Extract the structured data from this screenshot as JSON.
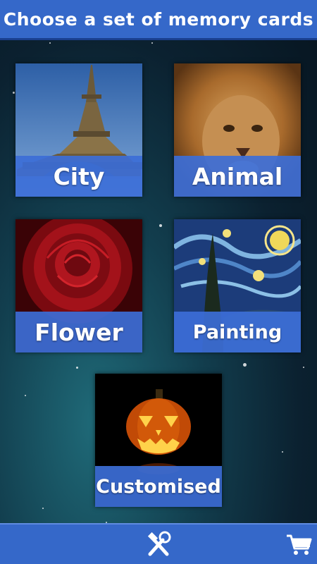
{
  "header": {
    "title": "Choose a set of memory cards"
  },
  "cards": [
    {
      "id": "city",
      "label": "City"
    },
    {
      "id": "animal",
      "label": "Animal"
    },
    {
      "id": "flower",
      "label": "Flower"
    },
    {
      "id": "painting",
      "label": "Painting"
    },
    {
      "id": "custom",
      "label": "Customised"
    }
  ],
  "bottom_bar": {
    "left_icon": "tools-icon",
    "right_icon": "cart-icon"
  },
  "colors": {
    "bar": "#3568c9",
    "label_bg": "#3c6ed7",
    "background": "#0b2130"
  }
}
